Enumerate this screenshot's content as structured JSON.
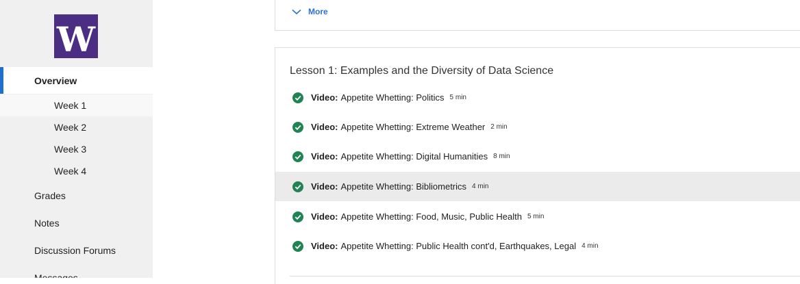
{
  "brand": {
    "logo_letter": "W",
    "logo_color": "#4b2e83"
  },
  "sidebar": {
    "overview_label": "Overview",
    "weeks": [
      "Week 1",
      "Week 2",
      "Week 3",
      "Week 4"
    ],
    "grades_label": "Grades",
    "notes_label": "Notes",
    "forums_label": "Discussion Forums",
    "messages_label": "Messages",
    "accent_color": "#1f6fcf"
  },
  "main": {
    "more_label": "More",
    "lesson": {
      "title": "Lesson 1: Examples and the Diversity of Data Science",
      "items": [
        {
          "kind": "Video:",
          "title": "Appetite Whetting: Politics",
          "duration": "5 min",
          "completed": true
        },
        {
          "kind": "Video:",
          "title": "Appetite Whetting: Extreme Weather",
          "duration": "2 min",
          "completed": true
        },
        {
          "kind": "Video:",
          "title": "Appetite Whetting: Digital Humanities",
          "duration": "8 min",
          "completed": true
        },
        {
          "kind": "Video:",
          "title": "Appetite Whetting: Bibliometrics",
          "duration": "4 min",
          "completed": true
        },
        {
          "kind": "Video:",
          "title": "Appetite Whetting: Food, Music, Public Health",
          "duration": "5 min",
          "completed": true
        },
        {
          "kind": "Video:",
          "title": "Appetite Whetting: Public Health cont'd, Earthquakes, Legal",
          "duration": "4 min",
          "completed": true
        }
      ],
      "check_color": "#1f8354"
    }
  }
}
